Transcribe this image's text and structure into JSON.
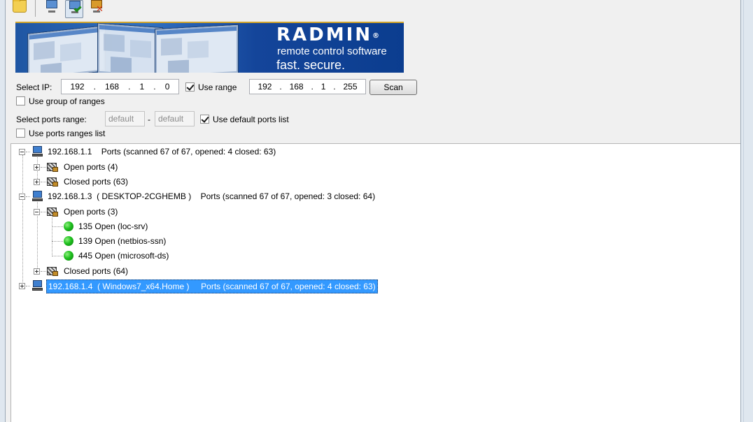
{
  "banner": {
    "brand": "RADMIN",
    "reg": "®",
    "tagline1": "remote control software",
    "tagline2": "fast. secure. affordable."
  },
  "controls": {
    "select_ip_label": "Select IP:",
    "ip_start": [
      "192",
      "168",
      "1",
      "0"
    ],
    "use_range_label": "Use range",
    "use_range_checked": true,
    "ip_end": [
      "192",
      "168",
      "1",
      "255"
    ],
    "scan_label": "Scan",
    "use_group_label": "Use group of ranges",
    "use_group_checked": false,
    "ports_range_label": "Select ports range:",
    "port_from": "default",
    "port_sep": "-",
    "port_to": "default",
    "use_default_ports_label": "Use default ports list",
    "use_default_ports_checked": true,
    "use_ports_ranges_label": "Use ports ranges list",
    "use_ports_ranges_checked": false
  },
  "tree": {
    "host1": {
      "ip": "192.168.1.1",
      "info": "Ports (scanned 67 of 67, opened: 4 closed: 63)"
    },
    "host1_open": "Open ports (4)",
    "host1_closed": "Closed ports (63)",
    "host2": {
      "ip": "192.168.1.3",
      "name": "( DESKTOP-2CGHEMB )",
      "info": "Ports (scanned 67 of 67, opened: 3 closed: 64)"
    },
    "host2_open": "Open ports (3)",
    "host2_ports": [
      "135 Open (loc-srv)",
      "139 Open (netbios-ssn)",
      "445 Open (microsoft-ds)"
    ],
    "host2_closed": "Closed ports (64)",
    "host3": {
      "ip": "192.168.1.4",
      "name": "( Windows7_x64.Home )",
      "info": "Ports (scanned 67 of 67, opened: 4 closed: 63)"
    }
  },
  "colors": {
    "selection": "#3399ff",
    "open_port": "#1fc01f",
    "banner": "#1f56a3"
  },
  "icons": [
    "folder-icon",
    "computer-icon",
    "scan-check-icon",
    "scan-stop-icon",
    "port-group-icon",
    "open-port-dot-icon"
  ]
}
